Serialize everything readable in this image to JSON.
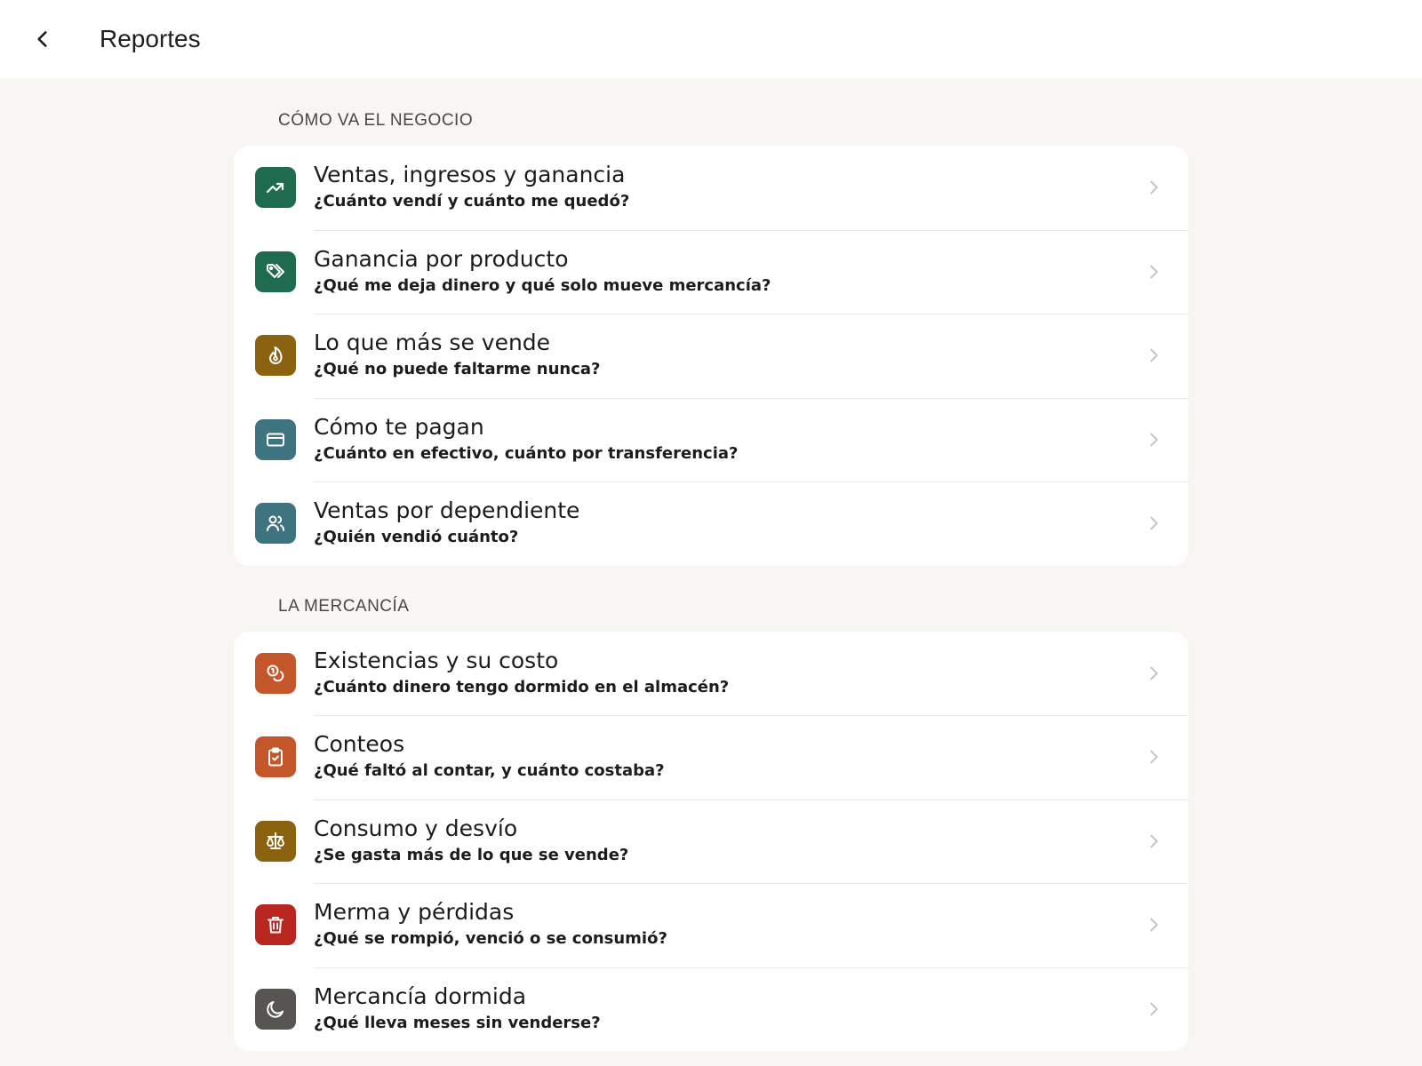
{
  "header": {
    "title": "Reportes",
    "back_icon": "chevron-left-icon"
  },
  "colors": {
    "green": "#1e6b4f",
    "amber": "#8a6210",
    "teal": "#3e7380",
    "orange": "#c4572a",
    "red": "#b8271f",
    "gray": "#575552",
    "background": "#f8f6f2"
  },
  "sections": [
    {
      "title": "CÓMO VA EL NEGOCIO",
      "items": [
        {
          "title": "Ventas, ingresos y ganancia",
          "subtitle": "¿Cuánto vendí y cuánto me quedó?",
          "icon": "trending-up-icon"
        },
        {
          "title": "Ganancia por producto",
          "subtitle": "¿Qué me deja dinero y qué solo mueve mercancía?",
          "icon": "tags-icon"
        },
        {
          "title": "Lo que más se vende",
          "subtitle": "¿Qué no puede faltarme nunca?",
          "icon": "flame-icon"
        },
        {
          "title": "Cómo te pagan",
          "subtitle": "¿Cuánto en efectivo, cuánto por transferencia?",
          "icon": "credit-card-icon"
        },
        {
          "title": "Ventas por dependiente",
          "subtitle": "¿Quién vendió cuánto?",
          "icon": "users-icon"
        }
      ]
    },
    {
      "title": "LA MERCANCÍA",
      "items": [
        {
          "title": "Existencias y su costo",
          "subtitle": "¿Cuánto dinero tengo dormido en el almacén?",
          "icon": "coins-icon"
        },
        {
          "title": "Conteos",
          "subtitle": "¿Qué faltó al contar, y cuánto costaba?",
          "icon": "clipboard-check-icon"
        },
        {
          "title": "Consumo y desvío",
          "subtitle": "¿Se gasta más de lo que se vende?",
          "icon": "scale-icon"
        },
        {
          "title": "Merma y pérdidas",
          "subtitle": "¿Qué se rompió, venció o se consumió?",
          "icon": "trash-icon"
        },
        {
          "title": "Mercancía dormida",
          "subtitle": "¿Qué lleva meses sin venderse?",
          "icon": "moon-icon"
        }
      ]
    }
  ]
}
